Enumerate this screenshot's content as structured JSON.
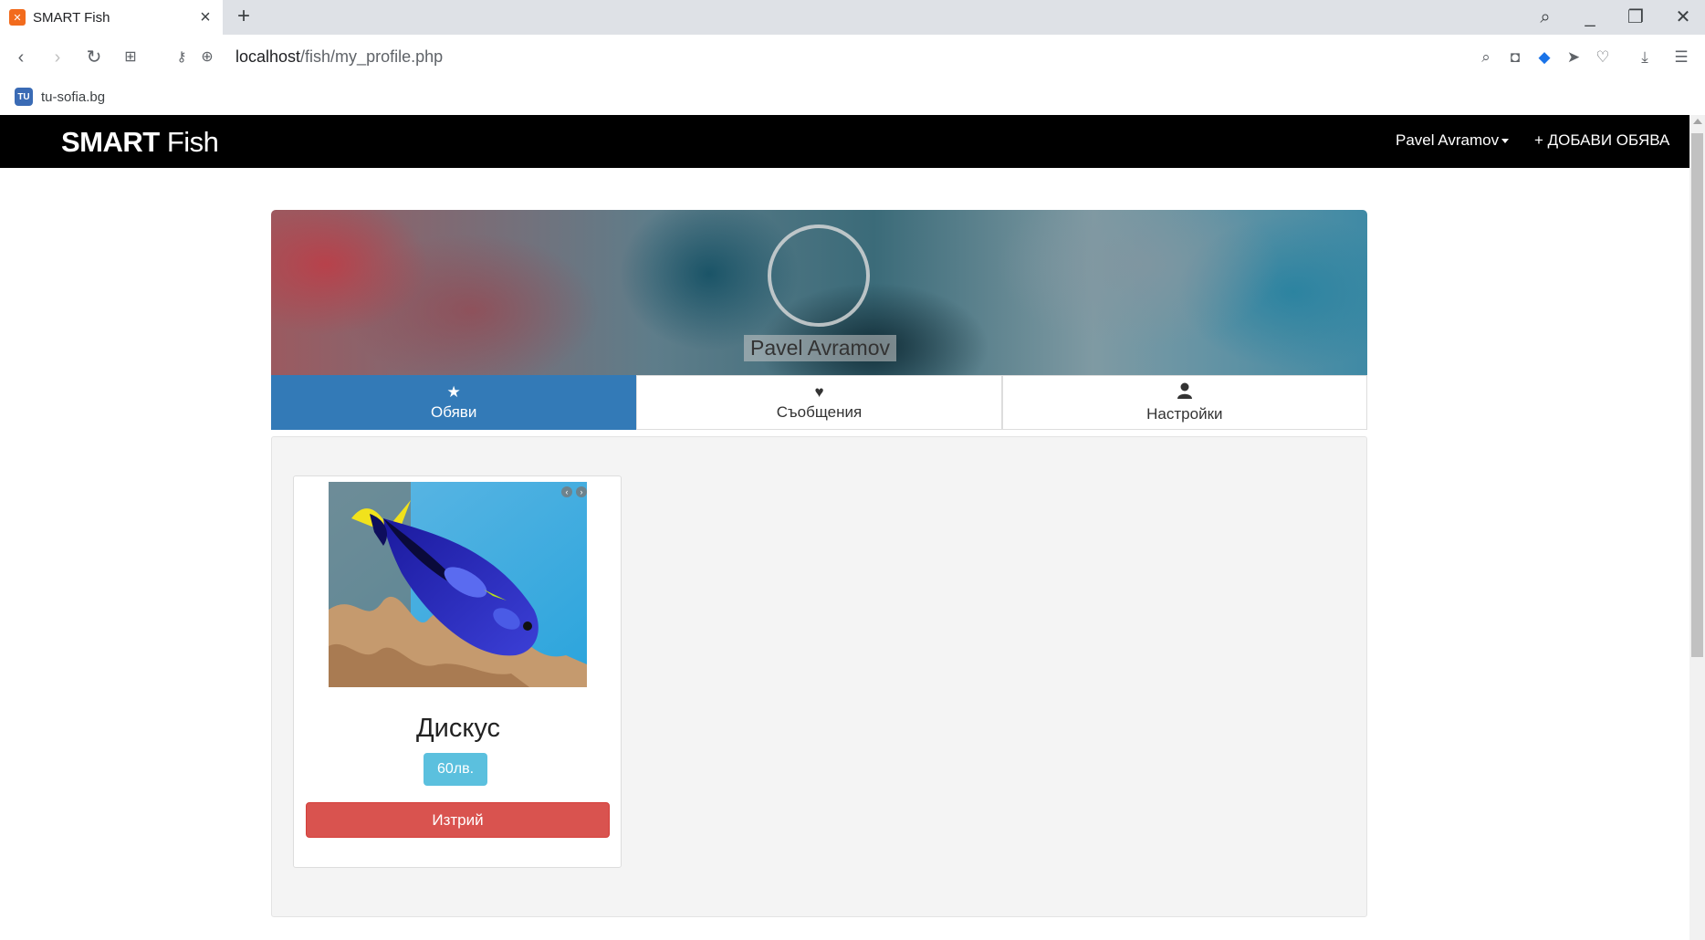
{
  "browser": {
    "tab_title": "SMART Fish",
    "url_host": "localhost",
    "url_path": "/fish/my_profile.php",
    "bookmark_label": "tu-sofia.bg"
  },
  "navbar": {
    "brand_bold": "SMART",
    "brand_rest": " Fish",
    "user_name": "Pavel Avramov",
    "add_ad_label": "+ ДОБАВИ ОБЯВА"
  },
  "profile": {
    "name": "Pavel Avramov"
  },
  "tabs": [
    {
      "icon": "star-icon",
      "glyph": "★",
      "label": "Обяви",
      "active": true
    },
    {
      "icon": "heart-icon",
      "glyph": "♥",
      "label": "Съобщения",
      "active": false
    },
    {
      "icon": "user-icon",
      "glyph": "👤",
      "label": "Настройки",
      "active": false
    }
  ],
  "listings": [
    {
      "title": "Дискус",
      "price": "60лв.",
      "delete_label": "Изтрий"
    }
  ],
  "colors": {
    "navbar": "#000000",
    "active_tab": "#337ab7",
    "price_badge": "#5bc0de",
    "delete_button": "#d9534f"
  }
}
